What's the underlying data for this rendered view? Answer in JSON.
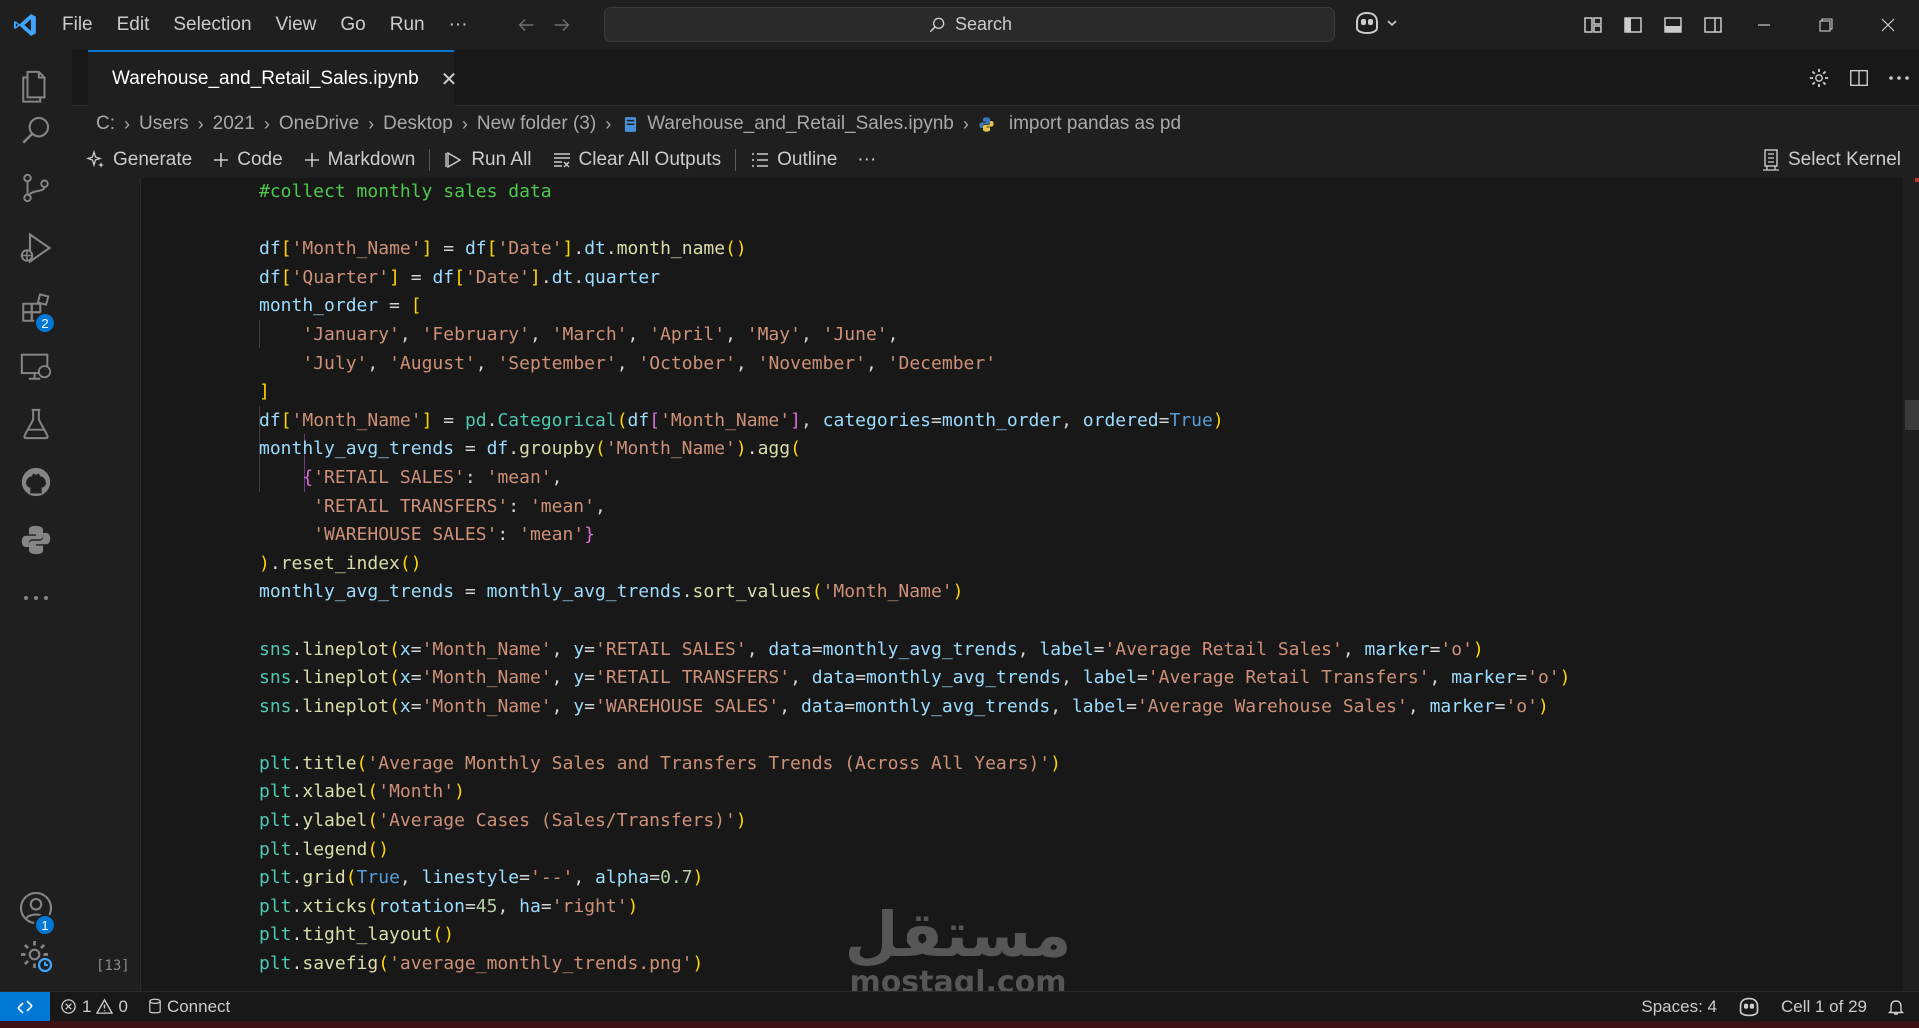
{
  "titlebar": {
    "menu": [
      "File",
      "Edit",
      "Selection",
      "View",
      "Go",
      "Run",
      "···"
    ],
    "search_label": "Search"
  },
  "activity_bar": {
    "items": [
      {
        "name": "explorer",
        "icon": "files-icon"
      },
      {
        "name": "search",
        "icon": "search-icon"
      },
      {
        "name": "source-control",
        "icon": "source-control-icon"
      },
      {
        "name": "run-and-debug",
        "icon": "run-debug-icon"
      },
      {
        "name": "extensions",
        "icon": "extensions-icon",
        "badge": "2"
      },
      {
        "name": "remote-explorer",
        "icon": "remote-explorer-icon"
      },
      {
        "name": "testing",
        "icon": "flask-icon"
      },
      {
        "name": "github",
        "icon": "github-icon"
      },
      {
        "name": "python",
        "icon": "python-icon"
      },
      {
        "name": "more",
        "icon": "more-icon"
      }
    ],
    "accounts_badge": "1"
  },
  "tab": {
    "label": "Warehouse_and_Retail_Sales.ipynb",
    "close": "✕"
  },
  "breadcrumb": [
    "C:",
    "Users",
    "2021",
    "OneDrive",
    "Desktop",
    "New folder (3)",
    "Warehouse_and_Retail_Sales.ipynb",
    "import pandas as pd"
  ],
  "notebook_toolbar": {
    "generate": "Generate",
    "code": "Code",
    "markdown": "Markdown",
    "run_all": "Run All",
    "clear_outputs": "Clear All Outputs",
    "outline": "Outline",
    "more": "···",
    "select_kernel": "Select Kernel"
  },
  "cell": {
    "execution_count": "[13]"
  },
  "statusbar": {
    "errors": "1",
    "warnings": "0",
    "connect": "Connect",
    "spaces": "Spaces: 4",
    "cell_position": "Cell 1 of 29"
  },
  "watermark": {
    "arabic": "مستقل",
    "latin": "mostaql.com"
  },
  "colors": {
    "accent": "#0078d4",
    "comment_highlight": "#4ec94e",
    "string": "#ce9178",
    "variable": "#9cdcfe",
    "function": "#dcdcaa",
    "keyword": "#569cd6"
  }
}
